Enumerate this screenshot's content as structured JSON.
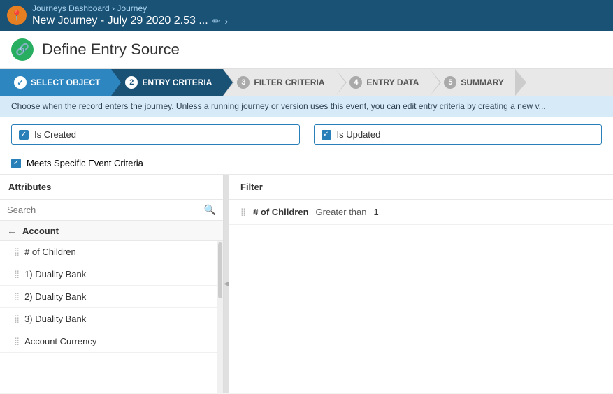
{
  "topbar": {
    "icon": "📍",
    "breadcrumb_link": "Journeys Dashboard",
    "breadcrumb_sep": ">",
    "breadcrumb_current": "Journey",
    "title": "New Journey - July 29 2020 2.53 ...",
    "edit_icon": "✏",
    "chevron": "›"
  },
  "section": {
    "icon": "🔗",
    "title": "Define Entry Source"
  },
  "steps": [
    {
      "num": "✓",
      "label": "SELECT OBJECT",
      "state": "completed"
    },
    {
      "num": "2",
      "label": "ENTRY CRITERIA",
      "state": "active"
    },
    {
      "num": "3",
      "label": "FILTER CRITERIA",
      "state": ""
    },
    {
      "num": "4",
      "label": "ENTRY DATA",
      "state": ""
    },
    {
      "num": "5",
      "label": "SUMMARY",
      "state": ""
    }
  ],
  "description": "Choose when the record enters the journey. Unless a running journey or version uses this event, you can edit entry criteria by creating a new v...",
  "criteria": {
    "is_created_label": "Is Created",
    "is_created_checked": true,
    "is_updated_label": "Is Updated",
    "is_updated_checked": true
  },
  "meets_specific": {
    "label": "Meets Specific Event Criteria",
    "checked": true
  },
  "attributes": {
    "title": "Attributes",
    "search_placeholder": "Search",
    "back_label": "Account",
    "items": [
      {
        "label": "# of Children"
      },
      {
        "label": "1) Duality Bank"
      },
      {
        "label": "2) Duality Bank"
      },
      {
        "label": "3) Duality Bank"
      },
      {
        "label": "Account Currency"
      }
    ]
  },
  "filter": {
    "title": "Filter",
    "rows": [
      {
        "field": "# of Children",
        "operator": "Greater than",
        "value": "1"
      }
    ]
  }
}
